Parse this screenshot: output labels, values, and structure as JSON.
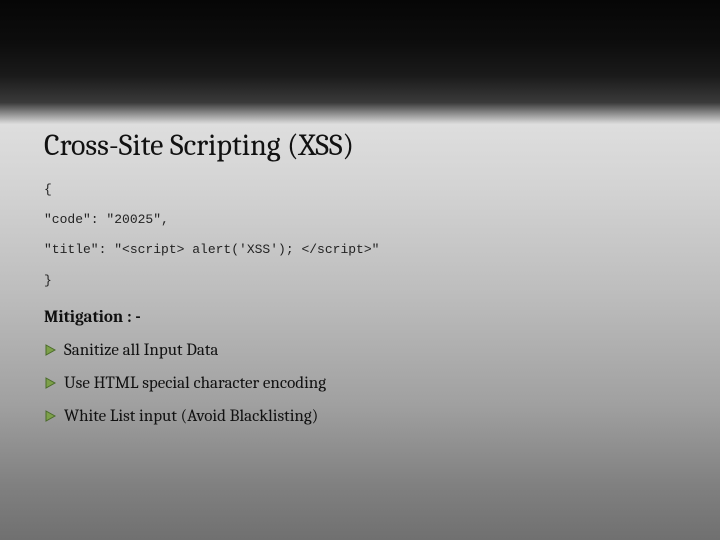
{
  "title": "Cross-Site Scripting (XSS)",
  "code": {
    "open": "{",
    "line1": "\"code\": \"20025\",",
    "line2": "\"title\": \"<script> alert('XSS'); </script>\"",
    "close": "}"
  },
  "mitigation_label": "Mitigation : -",
  "bullets": [
    "Sanitize all Input Data",
    "Use HTML special character encoding",
    "White List input (Avoid Blacklisting)"
  ],
  "bullet_icon": "triangle-right-icon",
  "colors": {
    "triangle_fill": "#7da04a",
    "triangle_stroke": "#4a6b2a"
  }
}
